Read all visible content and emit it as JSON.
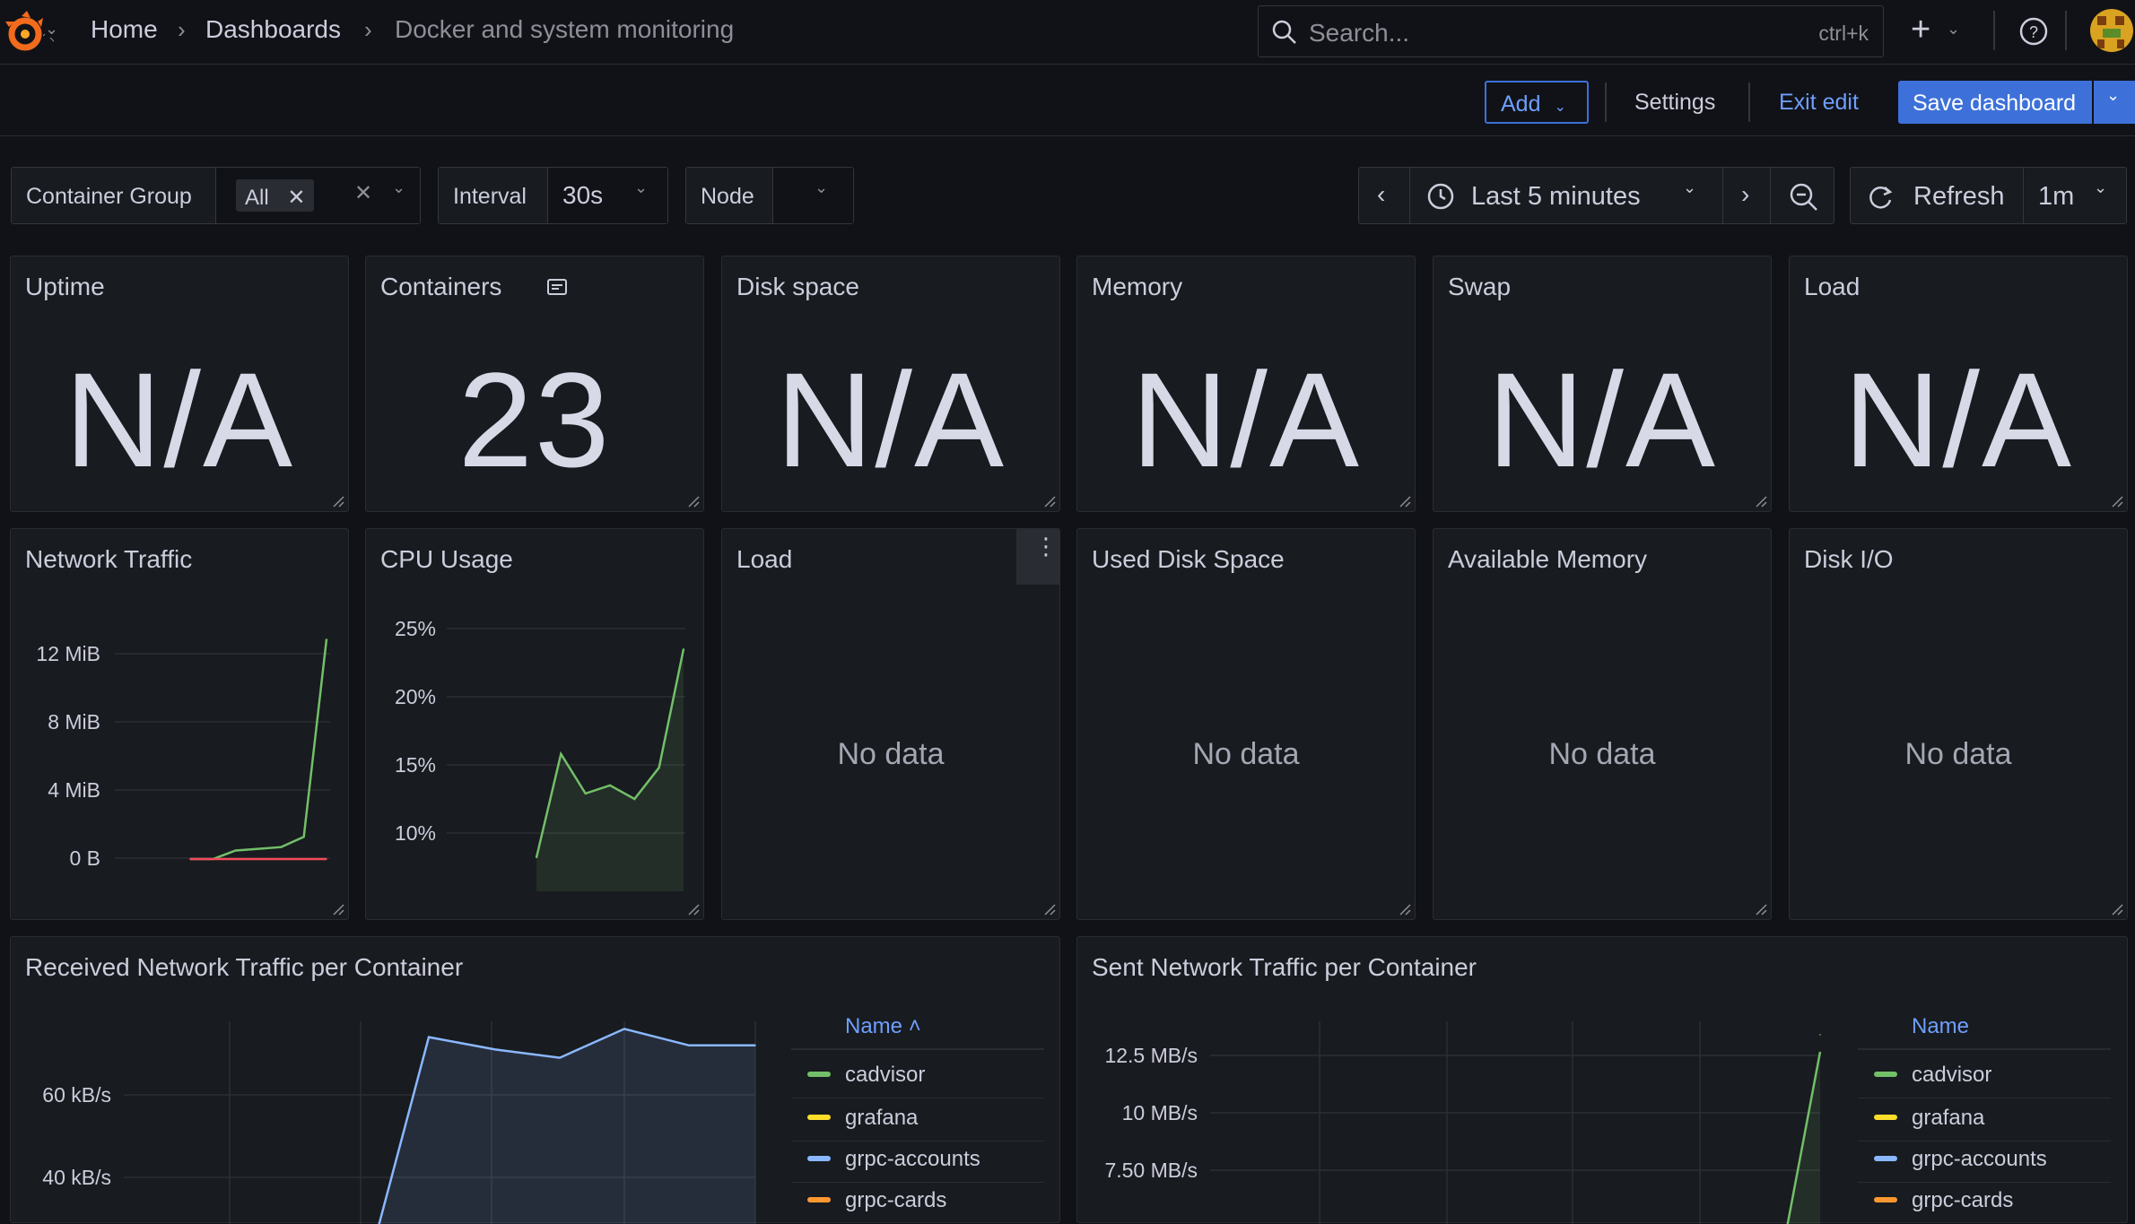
{
  "breadcrumb": {
    "home": "Home",
    "dashboards": "Dashboards",
    "current": "Docker and system monitoring"
  },
  "search": {
    "placeholder": "Search...",
    "shortcut": "ctrl+k"
  },
  "toolbar": {
    "add": "Add",
    "settings": "Settings",
    "exit_edit": "Exit edit",
    "save": "Save dashboard"
  },
  "variables": {
    "container_group": {
      "label": "Container Group",
      "value": "All"
    },
    "interval": {
      "label": "Interval",
      "value": "30s"
    },
    "node": {
      "label": "Node",
      "value": ""
    }
  },
  "time": {
    "range": "Last 5 minutes",
    "refresh": "Refresh",
    "refresh_interval": "1m"
  },
  "stats": [
    {
      "title": "Uptime",
      "value": "N/A"
    },
    {
      "title": "Containers",
      "value": "23"
    },
    {
      "title": "Disk space",
      "value": "N/A"
    },
    {
      "title": "Memory",
      "value": "N/A"
    },
    {
      "title": "Swap",
      "value": "N/A"
    },
    {
      "title": "Load",
      "value": "N/A"
    }
  ],
  "row2": [
    {
      "title": "Network Traffic"
    },
    {
      "title": "CPU Usage"
    },
    {
      "title": "Load",
      "text": "No data"
    },
    {
      "title": "Used Disk Space",
      "text": "No data"
    },
    {
      "title": "Available Memory",
      "text": "No data"
    },
    {
      "title": "Disk I/O",
      "text": "No data"
    }
  ],
  "bottom": {
    "received_title": "Received Network Traffic per Container",
    "sent_title": "Sent Network Traffic per Container",
    "legend_header_sorted": "Name ˄",
    "legend_header": "Name",
    "legend": [
      "cadvisor",
      "grafana",
      "grpc-accounts",
      "grpc-cards"
    ]
  },
  "colors": {
    "green": "#73bf69",
    "yellow": "#fade2a",
    "blue": "#8ab8ff",
    "orange": "#ff9830",
    "red": "#f2495c",
    "accent": "#3d71d9"
  },
  "chart_data": [
    {
      "type": "line",
      "title": "Network Traffic",
      "yticks": [
        "12 MiB",
        "8 MiB",
        "4 MiB",
        "0 B"
      ],
      "ylim": [
        0,
        13.5
      ],
      "series": [
        {
          "values": [
            0,
            0,
            0.5,
            0.6,
            0.7,
            1.3,
            12.9
          ]
        },
        {
          "values": [
            0,
            0,
            0,
            0,
            0,
            0,
            0
          ]
        }
      ]
    },
    {
      "type": "area",
      "title": "CPU Usage",
      "yticks": [
        "25%",
        "20%",
        "15%",
        "10%"
      ],
      "ylim": [
        5.5,
        25
      ],
      "series": [
        {
          "values": [
            8.2,
            15.8,
            12.9,
            13.5,
            12.5,
            14.8,
            23.5
          ]
        }
      ]
    },
    {
      "type": "area",
      "title": "Received Network Traffic per Container",
      "yticks": [
        "60 kB/s",
        "40 kB/s"
      ],
      "series": [
        {
          "name": "grpc-accounts",
          "values": [
            20,
            74,
            71,
            69,
            76,
            72,
            72
          ]
        }
      ]
    },
    {
      "type": "line",
      "title": "Sent Network Traffic per Container",
      "yticks": [
        "12.5 MB/s",
        "10 MB/s",
        "7.50 MB/s"
      ],
      "series": [
        {
          "name": "cadvisor",
          "values": [
            13.4
          ]
        }
      ]
    }
  ]
}
